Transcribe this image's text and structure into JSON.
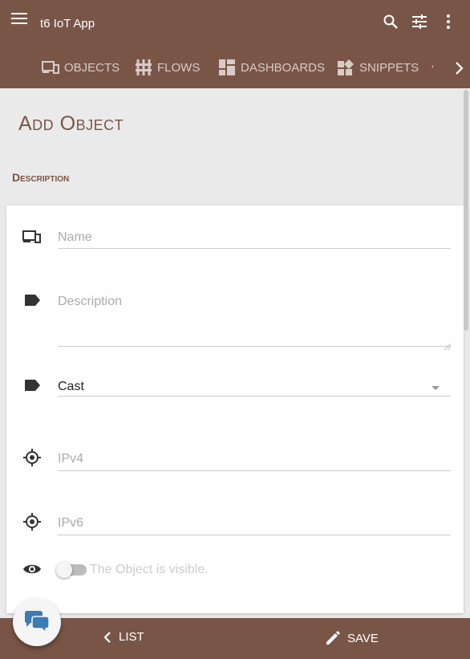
{
  "app": {
    "title": "t6 IoT App"
  },
  "topbar": {
    "icons": [
      "menu-icon",
      "search-icon",
      "tune-icon",
      "more-vert-icon"
    ]
  },
  "tabs": [
    {
      "label": "OBJECTS",
      "icon": "devices-icon"
    },
    {
      "label": "FLOWS",
      "icon": "flows-icon"
    },
    {
      "label": "DASHBOARDS",
      "icon": "dashboard-icon"
    },
    {
      "label": "SNIPPETS",
      "icon": "widgets-icon"
    }
  ],
  "tabs_overflow": {
    "partial_text": "'"
  },
  "page": {
    "title": "Add Object",
    "section": "Description"
  },
  "form": {
    "name": {
      "placeholder": "Name",
      "value": ""
    },
    "description": {
      "placeholder": "Description",
      "value": ""
    },
    "type": {
      "selected": "Cast"
    },
    "ipv4": {
      "placeholder": "IPv4",
      "value": ""
    },
    "ipv6": {
      "placeholder": "IPv6",
      "value": ""
    },
    "visibility": {
      "label": "The Object is visible.",
      "checked": false
    }
  },
  "bottombar": {
    "list_label": "LIST",
    "save_label": "SAVE"
  },
  "colors": {
    "brand": "#795548",
    "fab_icon": "#3d7bb6"
  }
}
